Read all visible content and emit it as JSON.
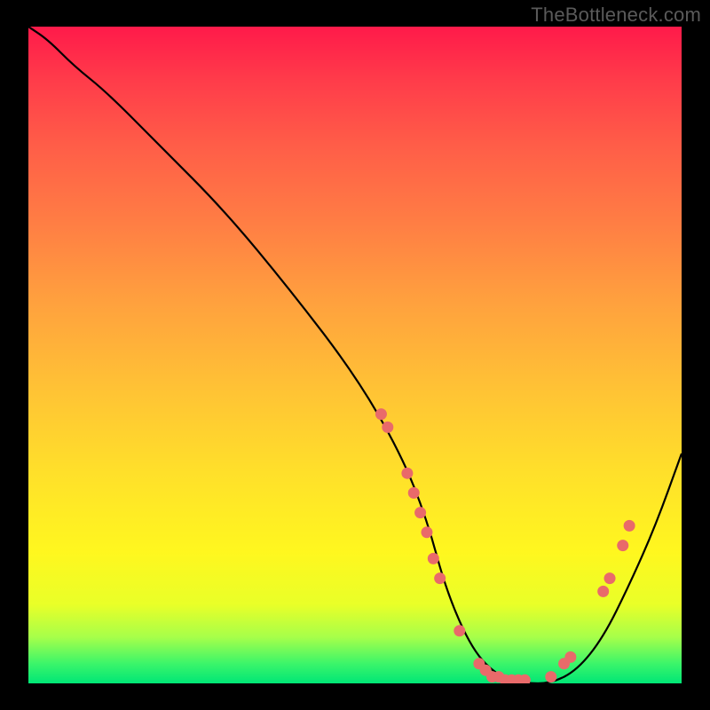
{
  "watermark": "TheBottleneck.com",
  "chart_data": {
    "type": "line",
    "title": "",
    "xlabel": "",
    "ylabel": "",
    "xlim": [
      0,
      100
    ],
    "ylim": [
      0,
      100
    ],
    "series": [
      {
        "name": "bottleneck-curve",
        "x": [
          0,
          3,
          7,
          12,
          20,
          30,
          40,
          50,
          57,
          61,
          64,
          68,
          72,
          76,
          80,
          84,
          88,
          92,
          96,
          100
        ],
        "values": [
          100,
          98,
          94,
          90,
          82,
          72,
          60,
          47,
          35,
          25,
          14,
          5,
          1,
          0,
          0,
          2,
          7,
          15,
          24,
          35
        ]
      }
    ],
    "markers": [
      {
        "x": 54,
        "y": 41
      },
      {
        "x": 55,
        "y": 39
      },
      {
        "x": 58,
        "y": 32
      },
      {
        "x": 59,
        "y": 29
      },
      {
        "x": 60,
        "y": 26
      },
      {
        "x": 61,
        "y": 23
      },
      {
        "x": 62,
        "y": 19
      },
      {
        "x": 63,
        "y": 16
      },
      {
        "x": 66,
        "y": 8
      },
      {
        "x": 69,
        "y": 3
      },
      {
        "x": 70,
        "y": 2
      },
      {
        "x": 71,
        "y": 1
      },
      {
        "x": 72,
        "y": 1
      },
      {
        "x": 73,
        "y": 0.5
      },
      {
        "x": 74,
        "y": 0.5
      },
      {
        "x": 75,
        "y": 0.5
      },
      {
        "x": 76,
        "y": 0.5
      },
      {
        "x": 80,
        "y": 1
      },
      {
        "x": 82,
        "y": 3
      },
      {
        "x": 83,
        "y": 4
      },
      {
        "x": 88,
        "y": 14
      },
      {
        "x": 89,
        "y": 16
      },
      {
        "x": 91,
        "y": 21
      },
      {
        "x": 92,
        "y": 24
      }
    ],
    "gradient_stops": [
      {
        "pos": 0,
        "color": "#ff1a4a"
      },
      {
        "pos": 8,
        "color": "#ff3b4a"
      },
      {
        "pos": 18,
        "color": "#ff5d48"
      },
      {
        "pos": 30,
        "color": "#ff7e44"
      },
      {
        "pos": 42,
        "color": "#ffa13e"
      },
      {
        "pos": 55,
        "color": "#ffc235"
      },
      {
        "pos": 68,
        "color": "#ffe02a"
      },
      {
        "pos": 80,
        "color": "#fff71f"
      },
      {
        "pos": 88,
        "color": "#e9ff28"
      },
      {
        "pos": 93,
        "color": "#a6ff4a"
      },
      {
        "pos": 97,
        "color": "#3bf56a"
      },
      {
        "pos": 100,
        "color": "#00e676"
      }
    ],
    "marker_color": "#e96a6a",
    "line_color": "#000000"
  }
}
